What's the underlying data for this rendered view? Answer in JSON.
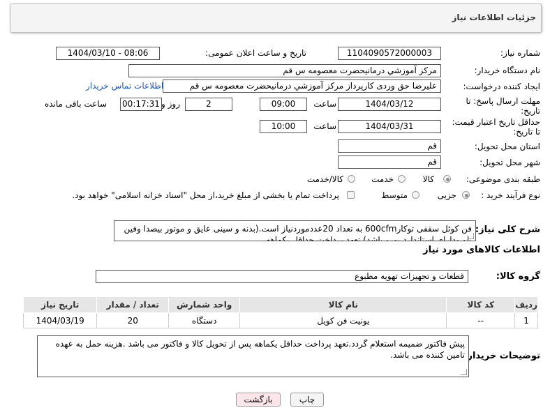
{
  "header": {
    "title": "جزئیات اطلاعات نیاز"
  },
  "form": {
    "need_number_label": "شماره نیاز:",
    "need_number": "1104090572000003",
    "announce_label": "تاریخ و ساعت اعلان عمومی:",
    "announce_value": "1404/03/10 - 08:06",
    "buyer_label": "نام دستگاه خریدار:",
    "buyer_value": "مرکز آموزشي درمانيحضرت معصومه س  قم",
    "creator_label": "ایجاد کننده درخواست:",
    "creator_value": "عليرضا حق وردی کارپرداز مرکز آموزشي درمانيحضرت معصومه س  قم",
    "contact_link": "اطلاعات تماس خریدار",
    "deadline_label_1": "مهلت ارسال پاسخ: تا",
    "deadline_label_2": "تاریخ:",
    "deadline_date": "1404/03/12",
    "time_word": "ساعت",
    "deadline_time": "09:00",
    "days_value": "2",
    "day_word": "روز و",
    "remaining_time": "00:17:31",
    "remaining_label": "ساعت باقی مانده",
    "validity_label_1": "حداقل تاریخ اعتبار قیمت:",
    "validity_label_2": "تا تاریخ:",
    "validity_date": "1404/03/31",
    "validity_time": "10:00",
    "province_label": "استان محل تحویل:",
    "province_value": "قم",
    "city_label": "شهر محل تحویل:",
    "city_value": "قم",
    "category_label": "طبقه بندی موضوعی:",
    "category_options": [
      "کالا",
      "خدمت",
      "کالا/خدمت"
    ],
    "purchase_label": "نوع فرآیند خرید :",
    "purchase_options": [
      "جزیی",
      "متوسط"
    ],
    "payment_note": "پرداخت تمام یا بخشی از مبلغ خرید،از محل \"اسناد خزانه اسلامی\" خواهد بود."
  },
  "description": {
    "label": "شرح کلی نیاز:",
    "text": "فن کوئل سقفی توکار600cfm به تعداد 20عددموردنیاز است.(بدنه و سینی عایق و موتور بیصدا وفین بلو ودارای استاندارد یورو باشد).تعهد پرداخت حداقل یکماهه"
  },
  "goods": {
    "section_title": "اطلاعات کالاهای مورد نیاز",
    "group_label": "گروه کالا:",
    "group_value": "قطعات و تجهیزات تهویه مطبوع",
    "columns": [
      "ردیف",
      "کد کالا",
      "نام کالا",
      "واحد شمارش",
      "تعداد / مقدار",
      "تاریخ نیاز"
    ],
    "rows": [
      {
        "row": "1",
        "code": "--",
        "name": "یونیت فن کویل",
        "unit": "دستگاه",
        "qty": "20",
        "date": "1404/03/19"
      }
    ]
  },
  "notes": {
    "label": "توضیحات خریدار:",
    "text": "پیش فاکتور ضمیمه استعلام گردد.تعهد پرداخت حداقل یکماهه پس از تحویل کالا و فاکتور می باشد .هزینه حمل به عهده تامین کننده می باشد."
  },
  "buttons": {
    "print": "چاپ",
    "back": "بازگشت"
  },
  "colors": {
    "panel_bg": "#f4f4f4",
    "table_header": "#e6e6e6",
    "back_button": "#fde6ea",
    "link": "#1a56c8"
  }
}
